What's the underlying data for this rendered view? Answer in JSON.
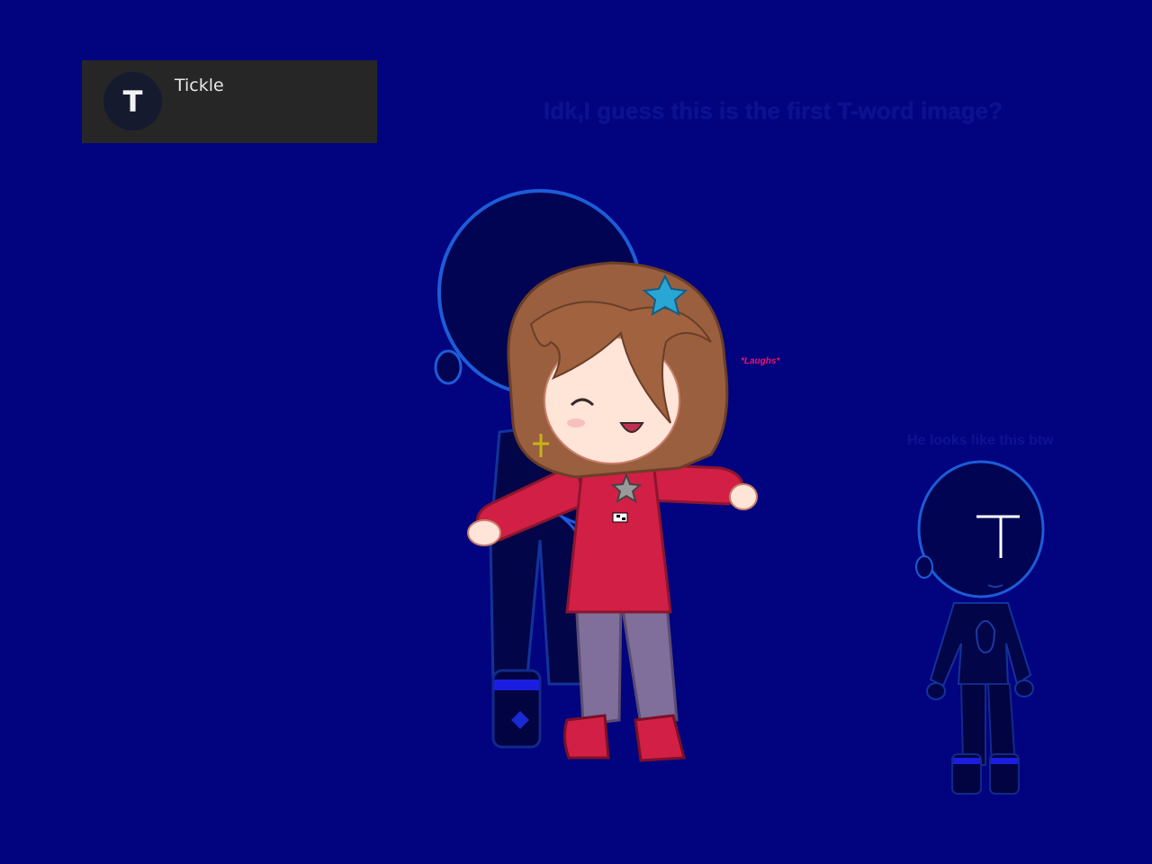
{
  "post": {
    "avatar_letter": "T",
    "title": "Tickle"
  },
  "caption": "Idk,I guess this is the first T-word image?",
  "character_sound": "*Laughs*",
  "side_note": "He looks like this btw",
  "colors": {
    "background": "#02037f",
    "card": "#262626",
    "shadow_figure": "#010452",
    "shadow_outline": "#1d5cd8",
    "sweater": "#d21f45",
    "hair": "#9a5f3f",
    "pants": "#7f6f9a",
    "star_clip": "#2aa6d4",
    "laugh_text": "#e8156f"
  },
  "icons": [
    "avatar-letter-icon",
    "star-hairclip-icon",
    "cross-earring-icon",
    "star-necklace-icon"
  ]
}
